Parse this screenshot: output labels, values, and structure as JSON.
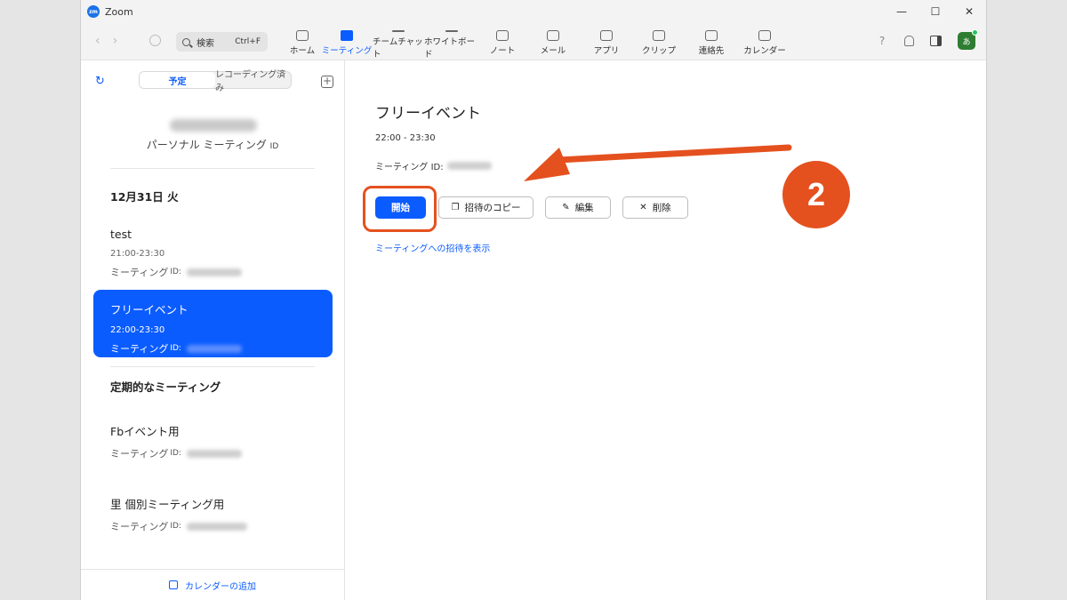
{
  "window": {
    "title": "Zoom",
    "minimize": "—",
    "maximize": "☐",
    "close": "✕"
  },
  "toolbar": {
    "back": "‹",
    "forward": "›",
    "search_label": "検索",
    "search_shortcut": "Ctrl+F",
    "tabs": [
      {
        "label": "ホーム",
        "icon": "home-icon"
      },
      {
        "label": "ミーティング",
        "icon": "video-camera-icon",
        "active": true
      },
      {
        "label": "チームチャット",
        "icon": "chat-icon"
      },
      {
        "label": "ホワイトボード",
        "icon": "whiteboard-icon"
      },
      {
        "label": "ノート",
        "icon": "note-icon"
      },
      {
        "label": "メール",
        "icon": "mail-icon"
      },
      {
        "label": "アプリ",
        "icon": "apps-icon"
      },
      {
        "label": "クリップ",
        "icon": "clip-icon"
      },
      {
        "label": "連絡先",
        "icon": "contacts-icon"
      },
      {
        "label": "カレンダー",
        "icon": "calendar-icon"
      }
    ],
    "help": "?",
    "avatar_initial": "あ"
  },
  "sidebar": {
    "refresh": "↻",
    "segment": {
      "scheduled": "予定",
      "recorded": "レコーディング済み"
    },
    "add": "+",
    "pmi": {
      "label": "パーソナル ミーティング",
      "suffix": "ID"
    },
    "date_heading": "12月31日 火",
    "meetings": [
      {
        "title": "test",
        "time": "21:00-23:30",
        "id_label": "ミーティング",
        "id_suffix": "ID:"
      },
      {
        "title": "フリーイベント",
        "time": "22:00-23:30",
        "id_label": "ミーティング",
        "id_suffix": "ID:"
      }
    ],
    "recurring_heading": "定期的なミーティング",
    "recurring": [
      {
        "title": "Fbイベント用",
        "id_label": "ミーティング",
        "id_suffix": "ID:"
      },
      {
        "title": "里 個別ミーティング用",
        "id_label": "ミーティング",
        "id_suffix": "ID:"
      }
    ],
    "add_calendar": "カレンダーの追加"
  },
  "main": {
    "title": "フリーイベント",
    "time": "22:00 - 23:30",
    "id_label": "ミーティング ID:",
    "buttons": {
      "start": "開始",
      "copy_invite": "招待のコピー",
      "edit": "編集",
      "delete": "削除"
    },
    "invite_link": "ミーティングへの招待を表示"
  },
  "annotation": {
    "step": "2"
  },
  "colors": {
    "accent": "#0b5cff",
    "annotation": "#e4511f"
  }
}
